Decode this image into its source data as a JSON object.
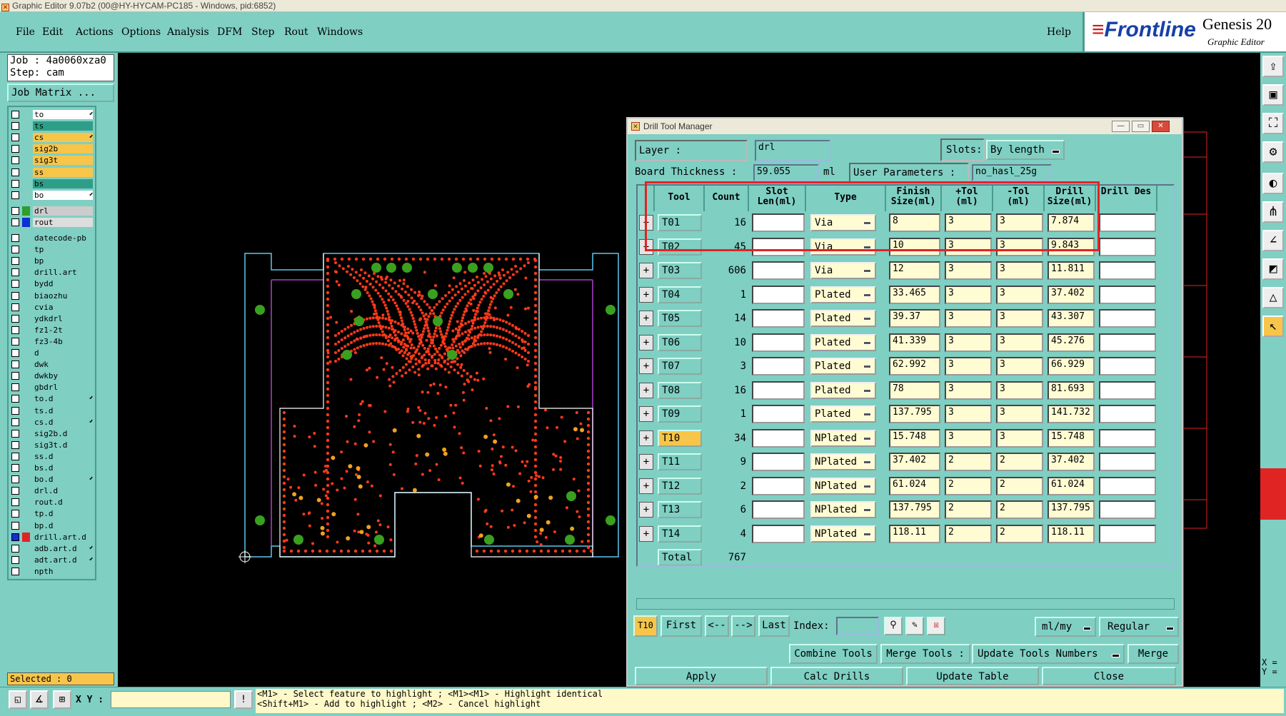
{
  "window": {
    "title": "Graphic Editor 9.07b2 (00@HY-HYCAM-PC185 - Windows, pid:6852)"
  },
  "menu": {
    "items": [
      "File",
      "Edit",
      "Actions",
      "Options",
      "Analysis",
      "DFM",
      "Step",
      "Rout",
      "Windows"
    ],
    "help": "Help"
  },
  "brand": {
    "logo": "Frontline",
    "product": "Genesis 20",
    "subtitle": "Graphic Editor"
  },
  "job": {
    "job": "Job : 4a0060xza0",
    "step": "Step: cam",
    "matrix_button": "Job Matrix ..."
  },
  "layers": [
    {
      "name": "to",
      "color": "#ffffff",
      "swatch": "#7fcfc3",
      "editable": true
    },
    {
      "name": "ts",
      "color": "#2e9e88",
      "swatch": "#7fcfc3",
      "editable": false
    },
    {
      "name": "cs",
      "color": "#f7c54a",
      "swatch": "#7fcfc3",
      "editable": true
    },
    {
      "name": "sig2b",
      "color": "#f7c54a",
      "swatch": "#7fcfc3",
      "editable": false
    },
    {
      "name": "sig3t",
      "color": "#f7c54a",
      "swatch": "#7fcfc3",
      "editable": false
    },
    {
      "name": "ss",
      "color": "#f7c54a",
      "swatch": "#7fcfc3",
      "editable": false
    },
    {
      "name": "bs",
      "color": "#2e9e88",
      "swatch": "#7fcfc3",
      "editable": false
    },
    {
      "name": "bo",
      "color": "#ffffff",
      "swatch": "#7fcfc3",
      "editable": true
    },
    {
      "name": "drl",
      "color": "#cccccc",
      "swatch": "#2e9e2e",
      "editable": false
    },
    {
      "name": "rout",
      "color": "#dddddd",
      "swatch": "#1030d0",
      "editable": false
    },
    {
      "name": "datecode-pb",
      "color": "#7fcfc3",
      "swatch": "#7fcfc3",
      "editable": false
    },
    {
      "name": "tp",
      "color": "#7fcfc3",
      "swatch": "#7fcfc3",
      "editable": false
    },
    {
      "name": "bp",
      "color": "#7fcfc3",
      "swatch": "#7fcfc3",
      "editable": false
    },
    {
      "name": "drill.art",
      "color": "#7fcfc3",
      "swatch": "#7fcfc3",
      "editable": false
    },
    {
      "name": "bydd",
      "color": "#7fcfc3",
      "swatch": "#7fcfc3",
      "editable": false
    },
    {
      "name": "biaozhu",
      "color": "#7fcfc3",
      "swatch": "#7fcfc3",
      "editable": false
    },
    {
      "name": "cvia",
      "color": "#7fcfc3",
      "swatch": "#7fcfc3",
      "editable": false
    },
    {
      "name": "ydkdrl",
      "color": "#7fcfc3",
      "swatch": "#7fcfc3",
      "editable": false
    },
    {
      "name": "fz1-2t",
      "color": "#7fcfc3",
      "swatch": "#7fcfc3",
      "editable": false
    },
    {
      "name": "fz3-4b",
      "color": "#7fcfc3",
      "swatch": "#7fcfc3",
      "editable": false
    },
    {
      "name": "d",
      "color": "#7fcfc3",
      "swatch": "#7fcfc3",
      "editable": false
    },
    {
      "name": "dwk",
      "color": "#7fcfc3",
      "swatch": "#7fcfc3",
      "editable": false
    },
    {
      "name": "dwkby",
      "color": "#7fcfc3",
      "swatch": "#7fcfc3",
      "editable": false
    },
    {
      "name": "gbdrl",
      "color": "#7fcfc3",
      "swatch": "#7fcfc3",
      "editable": false
    },
    {
      "name": "to.d",
      "color": "#7fcfc3",
      "swatch": "#7fcfc3",
      "editable": true
    },
    {
      "name": "ts.d",
      "color": "#7fcfc3",
      "swatch": "#7fcfc3",
      "editable": false
    },
    {
      "name": "cs.d",
      "color": "#7fcfc3",
      "swatch": "#7fcfc3",
      "editable": true
    },
    {
      "name": "sig2b.d",
      "color": "#7fcfc3",
      "swatch": "#7fcfc3",
      "editable": false
    },
    {
      "name": "sig3t.d",
      "color": "#7fcfc3",
      "swatch": "#7fcfc3",
      "editable": false
    },
    {
      "name": "ss.d",
      "color": "#7fcfc3",
      "swatch": "#7fcfc3",
      "editable": false
    },
    {
      "name": "bs.d",
      "color": "#7fcfc3",
      "swatch": "#7fcfc3",
      "editable": false
    },
    {
      "name": "bo.d",
      "color": "#7fcfc3",
      "swatch": "#7fcfc3",
      "editable": true
    },
    {
      "name": "drl.d",
      "color": "#7fcfc3",
      "swatch": "#7fcfc3",
      "editable": false
    },
    {
      "name": "rout.d",
      "color": "#7fcfc3",
      "swatch": "#7fcfc3",
      "editable": false
    },
    {
      "name": "tp.d",
      "color": "#7fcfc3",
      "swatch": "#7fcfc3",
      "editable": false
    },
    {
      "name": "bp.d",
      "color": "#7fcfc3",
      "swatch": "#7fcfc3",
      "editable": false
    },
    {
      "name": "drill.art.d",
      "color": "#7fcfc3",
      "swatch": "#e02424",
      "editable": false
    },
    {
      "name": "adb.art.d",
      "color": "#7fcfc3",
      "swatch": "#7fcfc3",
      "editable": true
    },
    {
      "name": "adt.art.d",
      "color": "#7fcfc3",
      "swatch": "#7fcfc3",
      "editable": true
    },
    {
      "name": "npth",
      "color": "#7fcfc3",
      "swatch": "#7fcfc3",
      "editable": false
    }
  ],
  "selected": "Selected : 0",
  "status": {
    "xy_label": "X Y :",
    "xy_value": "",
    "message_line1": "<M1> - Select feature to highlight ; <M1><M1> - Highlight identical",
    "message_line2": "<Shift+M1> - Add to highlight ; <M2> - Cancel highlight",
    "coord_x": "X =",
    "coord_y": "Y ="
  },
  "dialog": {
    "title": "Drill Tool Manager",
    "layer_label": "Layer :",
    "layer_value": "drl",
    "slots_label": "Slots:",
    "slots_value": "By length",
    "thickness_label": "Board Thickness :",
    "thickness_value": "59.055",
    "thickness_unit": "ml",
    "user_params_label": "User Parameters :",
    "user_params_value": "no_hasl_25g",
    "headers": [
      "Tool",
      "Count",
      "Slot Len(ml)",
      "Type",
      "Finish Size(ml)",
      "+Tol (ml)",
      "-Tol (ml)",
      "Drill Size(ml)",
      "Drill Des"
    ],
    "rows": [
      {
        "tool": "T01",
        "count": "16",
        "type": "Via",
        "finish": "8",
        "ptol": "3",
        "ntol": "3",
        "drill": "7.874"
      },
      {
        "tool": "T02",
        "count": "45",
        "type": "Via",
        "finish": "10",
        "ptol": "3",
        "ntol": "3",
        "drill": "9.843"
      },
      {
        "tool": "T03",
        "count": "606",
        "type": "Via",
        "finish": "12",
        "ptol": "3",
        "ntol": "3",
        "drill": "11.811"
      },
      {
        "tool": "T04",
        "count": "1",
        "type": "Plated",
        "finish": "33.465",
        "ptol": "3",
        "ntol": "3",
        "drill": "37.402"
      },
      {
        "tool": "T05",
        "count": "14",
        "type": "Plated",
        "finish": "39.37",
        "ptol": "3",
        "ntol": "3",
        "drill": "43.307"
      },
      {
        "tool": "T06",
        "count": "10",
        "type": "Plated",
        "finish": "41.339",
        "ptol": "3",
        "ntol": "3",
        "drill": "45.276"
      },
      {
        "tool": "T07",
        "count": "3",
        "type": "Plated",
        "finish": "62.992",
        "ptol": "3",
        "ntol": "3",
        "drill": "66.929"
      },
      {
        "tool": "T08",
        "count": "16",
        "type": "Plated",
        "finish": "78",
        "ptol": "3",
        "ntol": "3",
        "drill": "81.693"
      },
      {
        "tool": "T09",
        "count": "1",
        "type": "Plated",
        "finish": "137.795",
        "ptol": "3",
        "ntol": "3",
        "drill": "141.732"
      },
      {
        "tool": "T10",
        "count": "34",
        "type": "NPlated",
        "finish": "15.748",
        "ptol": "3",
        "ntol": "3",
        "drill": "15.748"
      },
      {
        "tool": "T11",
        "count": "9",
        "type": "NPlated",
        "finish": "37.402",
        "ptol": "2",
        "ntol": "2",
        "drill": "37.402"
      },
      {
        "tool": "T12",
        "count": "2",
        "type": "NPlated",
        "finish": "61.024",
        "ptol": "2",
        "ntol": "2",
        "drill": "61.024"
      },
      {
        "tool": "T13",
        "count": "6",
        "type": "NPlated",
        "finish": "137.795",
        "ptol": "2",
        "ntol": "2",
        "drill": "137.795"
      },
      {
        "tool": "T14",
        "count": "4",
        "type": "NPlated",
        "finish": "118.11",
        "ptol": "2",
        "ntol": "2",
        "drill": "118.11"
      }
    ],
    "selected_tool": "T10",
    "total_label": "Total",
    "total_count": "767",
    "nav": {
      "current": "T10",
      "first": "First",
      "prev": "<--",
      "next": "-->",
      "last": "Last",
      "index_label": "Index:",
      "units": "ml/my",
      "mode": "Regular"
    },
    "actions": {
      "combine": "Combine Tools",
      "merge_tools": "Merge Tools :",
      "update_numbers": "Update Tools Numbers",
      "merge": "Merge"
    },
    "bottom": {
      "apply": "Apply",
      "calc": "Calc Drills",
      "update_table": "Update Table",
      "close": "Close"
    }
  }
}
